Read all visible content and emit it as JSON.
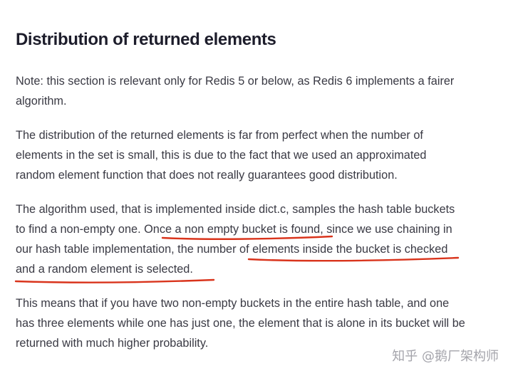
{
  "heading": "Distribution of returned elements",
  "paragraphs": {
    "note": [
      "Note: this section is relevant only for Redis 5 or below, as Redis 6 implements a fairer",
      "algorithm."
    ],
    "distribution": [
      "The distribution of the returned elements is far from perfect when the number of",
      "elements in the set is small, this is due to the fact that we used an approximated",
      "random element function that does not really guarantees good distribution."
    ],
    "algorithm": [
      "The algorithm used, that is implemented inside dict.c, samples the hash table buckets",
      "to find a non-empty one. Once a non empty bucket is found, since we use chaining in",
      "our hash table implementation, the number of elements inside the bucket is checked",
      "and a random element is selected."
    ],
    "probability": [
      "This means that if you have two non-empty buckets in the entire hash table, and one",
      "has three elements while one has just one, the element that is alone in its bucket will be",
      "returned with much higher probability."
    ]
  },
  "annotation_color": "#d9341c",
  "watermark": "知乎 @鹅厂架构师"
}
